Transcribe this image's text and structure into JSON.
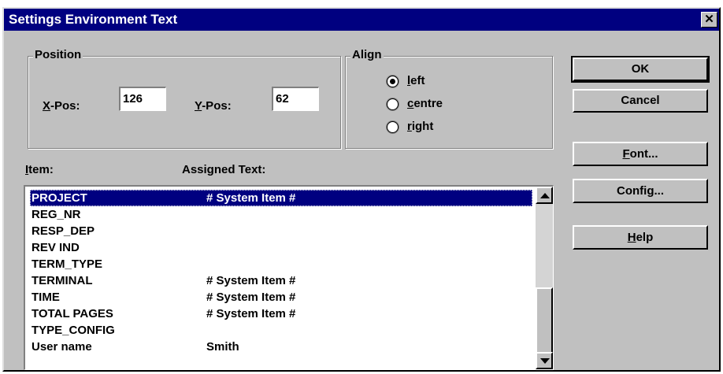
{
  "window": {
    "title": "Settings Environment Text",
    "close_glyph": "✕"
  },
  "position": {
    "label": "Position",
    "x_label_mnemonic": "X",
    "x_label_rest": "-Pos:",
    "x_value": "126",
    "y_label_mnemonic": "Y",
    "y_label_rest": "-Pos:",
    "y_value": "62"
  },
  "align": {
    "label": "Align",
    "options": [
      {
        "mnemonic": "l",
        "rest": "eft",
        "selected": true
      },
      {
        "mnemonic": "c",
        "rest": "entre",
        "selected": false
      },
      {
        "mnemonic": "r",
        "rest": "ight",
        "selected": false
      }
    ]
  },
  "list": {
    "item_header_mnemonic": "I",
    "item_header_rest": "tem:",
    "assigned_header": "Assigned Text:",
    "rows": [
      {
        "item": "PROJECT",
        "text": "# System Item #",
        "selected": true
      },
      {
        "item": "REG_NR",
        "text": ""
      },
      {
        "item": "RESP_DEP",
        "text": ""
      },
      {
        "item": "REV IND",
        "text": ""
      },
      {
        "item": "TERM_TYPE",
        "text": ""
      },
      {
        "item": "TERMINAL",
        "text": "# System Item #"
      },
      {
        "item": "TIME",
        "text": "# System Item #"
      },
      {
        "item": "TOTAL PAGES",
        "text": "# System Item #"
      },
      {
        "item": "TYPE_CONFIG",
        "text": ""
      },
      {
        "item": "User name",
        "text": "Smith"
      }
    ]
  },
  "buttons": {
    "ok": "OK",
    "cancel": "Cancel",
    "font_mnemonic": "F",
    "font_rest": "ont...",
    "config_pre": "Confi",
    "config_mnemonic": "g",
    "config_post": "...",
    "help_mnemonic": "H",
    "help_rest": "elp"
  }
}
